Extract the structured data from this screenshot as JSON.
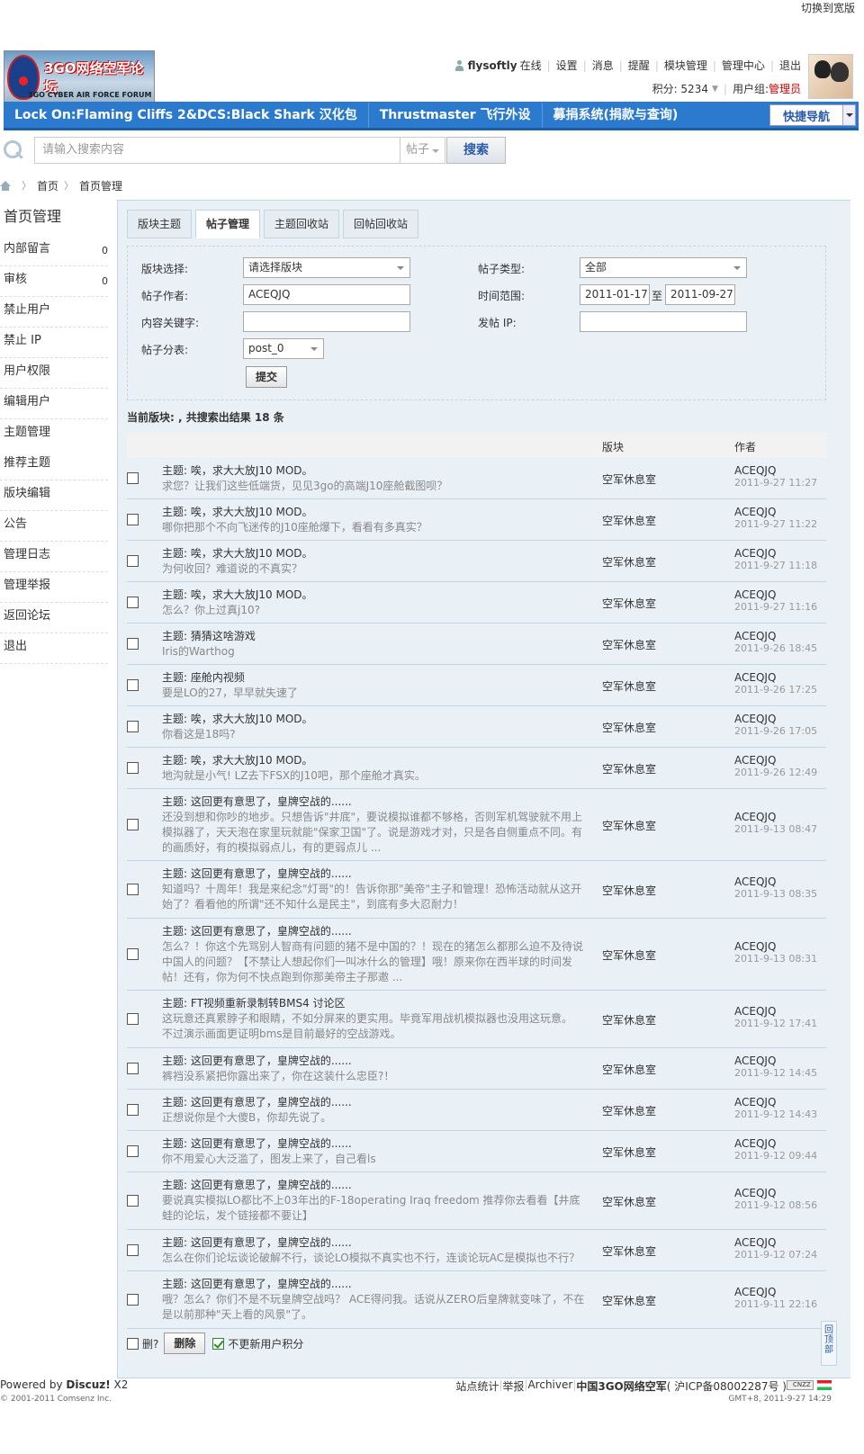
{
  "top": {
    "wide_label": "切换到宽版"
  },
  "logo": {
    "text_cn": "3GO网络空军论坛",
    "text_en": "3GO CYBER AIR FORCE FORUM"
  },
  "user": {
    "name": "flysoftly",
    "status": "在线",
    "links": [
      "设置",
      "消息",
      "提醒",
      "模块管理",
      "管理中心",
      "退出"
    ],
    "credit_label": "积分: 5234",
    "group_label": "用户组: ",
    "group": "管理员"
  },
  "nav": {
    "items": [
      "Lock On:Flaming Cliffs 2&DCS:Black Shark 汉化包",
      "Thrustmaster 飞行外设",
      "募捐系统(捐款与查询)"
    ],
    "quick": "快捷导航"
  },
  "search": {
    "placeholder": "请输入搜索内容",
    "type": "帖子",
    "button": "搜索"
  },
  "breadcrumb": {
    "home": "首页",
    "current": "首页管理"
  },
  "sidebar": {
    "title": "首页管理",
    "items": [
      {
        "label": "内部留言",
        "count": "0"
      },
      {
        "label": "审核",
        "count": "0"
      },
      {
        "label": "禁止用户"
      },
      {
        "label": "禁止 IP"
      },
      {
        "label": "用户权限"
      },
      {
        "label": "编辑用户"
      },
      {
        "label": "主题管理",
        "active": true
      },
      {
        "label": "推荐主题"
      },
      {
        "label": "版块编辑"
      },
      {
        "label": "公告"
      },
      {
        "label": "管理日志"
      },
      {
        "label": "管理举报"
      },
      {
        "label": "返回论坛"
      },
      {
        "label": "退出"
      }
    ]
  },
  "tabs": [
    {
      "label": "版块主题"
    },
    {
      "label": "帖子管理",
      "active": true
    },
    {
      "label": "主题回收站"
    },
    {
      "label": "回帖回收站"
    }
  ],
  "filter": {
    "forum_label": "版块选择:",
    "forum_value": "请选择版块",
    "type_label": "帖子类型:",
    "type_value": "全部",
    "author_label": "帖子作者:",
    "author_value": "ACEQJQ",
    "time_label": "时间范围:",
    "time_from": "2011-01-17",
    "time_sep": "至",
    "time_to": "2011-09-27",
    "keyword_label": "内容关键字:",
    "ip_label": "发帖 IP:",
    "table_label": "帖子分表:",
    "table_value": "post_0",
    "submit": "提交"
  },
  "summary": "当前版块: , 共搜索出结果 18 条",
  "table": {
    "col_forum": "版块",
    "col_author": "作者"
  },
  "posts": [
    {
      "subject": "主题: 唉，求大大放J10 MOD。",
      "message": "求您？让我们这些低端货，见见3go的高端J10座舱截图呗？",
      "forum": "空军休息室",
      "author": "ACEQJQ",
      "date": "2011-9-27 11:27",
      "h": 46
    },
    {
      "subject": "主题: 唉，求大大放J10 MOD。",
      "message": "哪你把那个不向飞迷传的J10座舱爆下，看看有多真实？",
      "forum": "空军休息室",
      "author": "ACEQJQ",
      "date": "2011-9-27 11:22",
      "h": 46
    },
    {
      "subject": "主题: 唉，求大大放J10 MOD。",
      "message": "为何收回？难道说的不真实？",
      "forum": "空军休息室",
      "author": "ACEQJQ",
      "date": "2011-9-27 11:18",
      "h": 46
    },
    {
      "subject": "主题: 唉，求大大放J10 MOD。",
      "message": "怎么？你上过真j10?",
      "forum": "空军休息室",
      "author": "ACEQJQ",
      "date": "2011-9-27 11:16",
      "h": 46
    },
    {
      "subject": "主题: 猜猜这啥游戏",
      "message": "Iris的Warthog",
      "forum": "空军休息室",
      "author": "ACEQJQ",
      "date": "2011-9-26 18:45",
      "h": 46
    },
    {
      "subject": "主题: 座舱内视频",
      "message": "要是LO的27，早早就失速了",
      "forum": "空军休息室",
      "author": "ACEQJQ",
      "date": "2011-9-26 17:25",
      "h": 46
    },
    {
      "subject": "主题: 唉，求大大放J10 MOD。",
      "message": "你看这是18吗?",
      "forum": "空军休息室",
      "author": "ACEQJQ",
      "date": "2011-9-26 17:05",
      "h": 46
    },
    {
      "subject": "主题: 唉，求大大放J10 MOD。",
      "message": "地沟就是小气! LZ去下FSX的J10吧，那个座舱才真实。",
      "forum": "空军休息室",
      "author": "ACEQJQ",
      "date": "2011-9-26 12:49",
      "h": 46
    },
    {
      "subject": "主题: 这回更有意思了，皇牌空战的......",
      "message": "还没到想和你吵的地步。只想告诉\"井底\"，要说模拟谁都不够格，否则军机驾驶就不用上模拟器了，天天泡在家里玩就能\"保家卫国\"了。说是游戏才对，只是各自侧重点不同。有的画质好，有的模拟弱点儿，有的更弱点儿 ...",
      "forum": "空军休息室",
      "author": "ACEQJQ",
      "date": "2011-9-13 08:47",
      "h": 80
    },
    {
      "subject": "主题: 这回更有意思了，皇牌空战的......",
      "message": "知道吗？十周年！我是来纪念\"灯哥\"的！告诉你那\"美帝\"主子和管理！恐怖活动就从这开始了？看看他的所谓\"还不知什么是民主\"，到底有多大忍耐力！",
      "forum": "空军休息室",
      "author": "ACEQJQ",
      "date": "2011-9-13 08:35",
      "h": 64
    },
    {
      "subject": "主题: 这回更有意思了，皇牌空战的......",
      "message": "怎么？！你这个先骂别人智商有问题的猪不是中国的？！现在的猪怎么都那么迫不及待说中国人的问题？【不禁让人想起你们一叫冰什么的管理】哦！原来你在西半球的时间发帖！还有，你为何不快点跑到你那美帝主子那邀 ...",
      "forum": "空军休息室",
      "author": "ACEQJQ",
      "date": "2011-9-13 08:31",
      "h": 80
    },
    {
      "subject": "主题: FT视频重新录制转BMS4 讨论区",
      "message": "这玩意还真累脖子和眼睛，不如分屏来的更实用。毕竟军用战机模拟器也没用这玩意。 不过演示画面更证明bms是目前最好的空战游戏。",
      "forum": "空军休息室",
      "author": "ACEQJQ",
      "date": "2011-9-12 17:41",
      "h": 64
    },
    {
      "subject": "主题: 这回更有意思了，皇牌空战的......",
      "message": "裤裆没系紧把你露出来了，你在这装什么忠臣?！",
      "forum": "空军休息室",
      "author": "ACEQJQ",
      "date": "2011-9-12 14:45",
      "h": 46
    },
    {
      "subject": "主题: 这回更有意思了，皇牌空战的......",
      "message": "正想说你是个大傻B，你却先说了。",
      "forum": "空军休息室",
      "author": "ACEQJQ",
      "date": "2011-9-12 14:43",
      "h": 46
    },
    {
      "subject": "主题: 这回更有意思了，皇牌空战的......",
      "message": "你不用爱心大泛滥了，图发上来了，自己看ls",
      "forum": "空军休息室",
      "author": "ACEQJQ",
      "date": "2011-9-12 09:44",
      "h": 46
    },
    {
      "subject": "主题: 这回更有意思了，皇牌空战的......",
      "message": "要说真实模拟LO都比不上03年出的F-18operating Iraq freedom 推荐你去看看【井底蛙的论坛，发个链接都不要让】",
      "forum": "空军休息室",
      "author": "ACEQJQ",
      "date": "2011-9-12 08:56",
      "h": 64
    },
    {
      "subject": "主题: 这回更有意思了，皇牌空战的......",
      "message": "怎么在你们论坛谈论破解不行，谈论LO模拟不真实也不行，连谈论玩AC是模拟也不行？",
      "forum": "空军休息室",
      "author": "ACEQJQ",
      "date": "2011-9-12 07:24",
      "h": 46
    },
    {
      "subject": "主题: 这回更有意思了，皇牌空战的......",
      "message": "哦？怎么？你们不是不玩皇牌空战吗？ ACE得问我。话说从ZERO后皇牌就变味了，不在是以前那种\"天上看的风景\"了。",
      "forum": "空军休息室",
      "author": "ACEQJQ",
      "date": "2011-9-11 22:16",
      "h": 64
    }
  ],
  "actions": {
    "del_all": "删?",
    "delete": "删除",
    "no_update": "不更新用户积分"
  },
  "totop": "回顶部",
  "footer": {
    "powered": "Powered by ",
    "discuz": "Discuz!",
    "version": " X2",
    "copyright": "© 2001-2011 Comsenz Inc.",
    "links": [
      "站点统计",
      "举报",
      "Archiver",
      "中国3GO网络空军",
      "( 沪ICP备08002287号 )"
    ],
    "gmt": "GMT+8, 2011-9-27 14:29",
    "cnzz": "CNZZ"
  }
}
